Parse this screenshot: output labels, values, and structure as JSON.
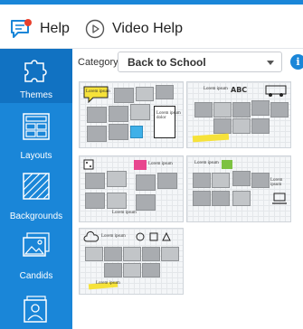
{
  "helpbar": {
    "help_label": "Help",
    "video_label": "Video Help"
  },
  "sidebar": {
    "items": [
      {
        "label": "Themes",
        "icon": "puzzle-icon"
      },
      {
        "label": "Layouts",
        "icon": "layout-icon"
      },
      {
        "label": "Backgrounds",
        "icon": "backgrounds-icon"
      },
      {
        "label": "Candids",
        "icon": "image-icon"
      },
      {
        "label": "",
        "icon": "portrait-icon"
      }
    ]
  },
  "category": {
    "label": "Category:",
    "value": "Back to School",
    "info_icon": "info-icon"
  },
  "thumbs": [
    {
      "note1": "Lorem ipsum",
      "note2": "Lorem ipsum dolor"
    },
    {
      "note1": "Lorem ipsum",
      "note2": "ABC"
    },
    {
      "note1": "Lorem ipsum",
      "note2": "Lorem ipsum"
    },
    {
      "note1": "Lorem ipsum",
      "note2": "Lorem ipsum"
    },
    {
      "note1": "Lorem ipsum",
      "note2": "Lorem ipsum"
    }
  ],
  "colors": {
    "accent": "#1a86d8",
    "active": "#1172c2"
  }
}
